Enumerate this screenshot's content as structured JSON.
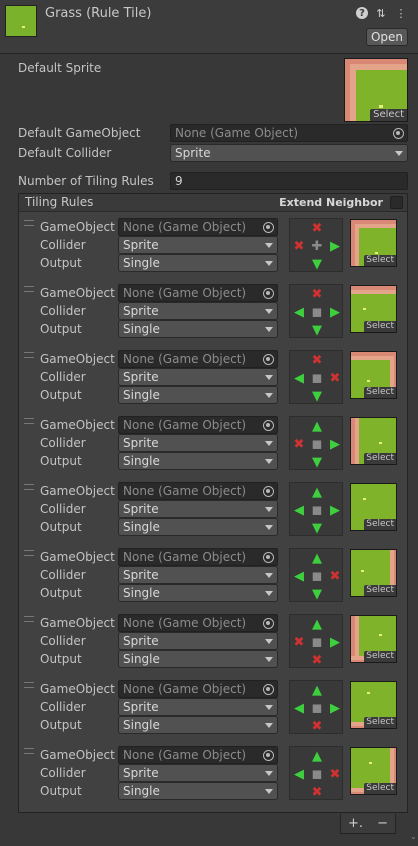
{
  "header": {
    "title": "Grass (Rule Tile)",
    "open_label": "Open",
    "icons": [
      "help-icon",
      "settings-sliders-icon",
      "more-icon"
    ]
  },
  "fields": {
    "default_sprite_label": "Default Sprite",
    "default_gameobject_label": "Default GameObject",
    "default_gameobject_value": "None (Game Object)",
    "default_collider_label": "Default Collider",
    "default_collider_value": "Sprite",
    "number_rules_label": "Number of Tiling Rules",
    "number_rules_value": "9",
    "select_label": "Select"
  },
  "tiling_rules": {
    "title": "Tiling Rules",
    "extend_neighbor_label": "Extend Neighbor",
    "extend_neighbor_checked": false,
    "row_labels": {
      "gameobject": "GameObject",
      "collider": "Collider",
      "output": "Output"
    },
    "rules": [
      {
        "gameobject": "None (Game Object)",
        "collider": "Sprite",
        "output": "Single",
        "neighbors": {
          "up": "x",
          "left": "x",
          "right": "arrow",
          "down": "arrow",
          "center": "plus"
        }
      },
      {
        "gameobject": "None (Game Object)",
        "collider": "Sprite",
        "output": "Single",
        "neighbors": {
          "up": "x",
          "left": "arrow",
          "right": "arrow",
          "down": "arrow"
        }
      },
      {
        "gameobject": "None (Game Object)",
        "collider": "Sprite",
        "output": "Single",
        "neighbors": {
          "up": "x",
          "left": "arrow",
          "right": "x",
          "down": "arrow"
        }
      },
      {
        "gameobject": "None (Game Object)",
        "collider": "Sprite",
        "output": "Single",
        "neighbors": {
          "up": "arrow",
          "left": "x",
          "right": "arrow",
          "down": "arrow"
        }
      },
      {
        "gameobject": "None (Game Object)",
        "collider": "Sprite",
        "output": "Single",
        "neighbors": {
          "up": "arrow",
          "left": "arrow",
          "right": "arrow",
          "down": "arrow"
        }
      },
      {
        "gameobject": "None (Game Object)",
        "collider": "Sprite",
        "output": "Single",
        "neighbors": {
          "up": "arrow",
          "left": "arrow",
          "right": "x",
          "down": "arrow"
        }
      },
      {
        "gameobject": "None (Game Object)",
        "collider": "Sprite",
        "output": "Single",
        "neighbors": {
          "up": "arrow",
          "left": "x",
          "right": "arrow",
          "down": "x"
        }
      },
      {
        "gameobject": "None (Game Object)",
        "collider": "Sprite",
        "output": "Single",
        "neighbors": {
          "up": "arrow",
          "left": "arrow",
          "right": "arrow",
          "down": "x"
        }
      },
      {
        "gameobject": "None (Game Object)",
        "collider": "Sprite",
        "output": "Single",
        "neighbors": {
          "up": "arrow",
          "left": "arrow",
          "right": "x",
          "down": "x"
        }
      }
    ],
    "add_label": "+.",
    "remove_label": "−"
  },
  "colors": {
    "bg": "#383838",
    "grass": "#7fb32a",
    "border_pink": "#d98876",
    "border_peach": "#e3a48a",
    "arrow_green": "#3dcf3d",
    "x_red": "#d03232"
  }
}
